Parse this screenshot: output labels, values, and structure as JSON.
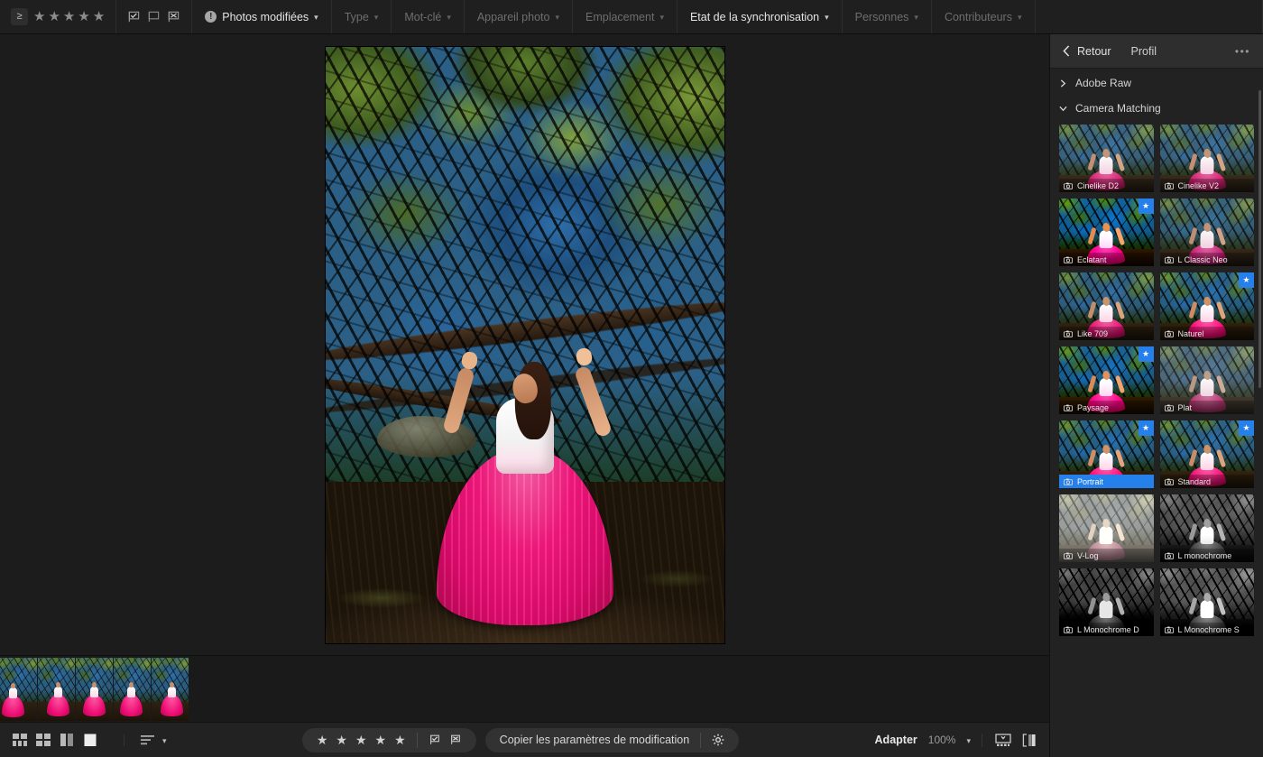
{
  "topbar": {
    "operator_label": "≥",
    "stars": [
      "star",
      "star",
      "star",
      "star",
      "star"
    ],
    "flags": [
      "flag-picked-icon",
      "flag-unflagged-icon",
      "flag-rejected-icon"
    ],
    "filters": [
      {
        "label": "Photos modifiées",
        "icon": "info-icon",
        "active": true
      },
      {
        "label": "Type",
        "active": false
      },
      {
        "label": "Mot-clé",
        "active": false
      },
      {
        "label": "Appareil photo",
        "active": false
      },
      {
        "label": "Emplacement",
        "active": false
      },
      {
        "label": "Etat de la synchronisation",
        "active": true
      },
      {
        "label": "Personnes",
        "active": false
      },
      {
        "label": "Contributeurs",
        "active": false
      }
    ]
  },
  "right_panel": {
    "back_label": "Retour",
    "title": "Profil",
    "more_label": "•••",
    "accent_color": "#2680eb",
    "groups": [
      {
        "name": "Adobe Raw",
        "expanded": false,
        "chevron": "chevron-right-icon"
      },
      {
        "name": "Camera Matching",
        "expanded": true,
        "chevron": "chevron-down-icon"
      }
    ],
    "profiles": [
      {
        "label": "Cinelike D2",
        "look": "look-cinelike",
        "favorite": false,
        "selected": false
      },
      {
        "label": "Cinelike V2",
        "look": "look-cinelike",
        "favorite": false,
        "selected": false
      },
      {
        "label": "Eclatant",
        "look": "look-eclatant",
        "favorite": true,
        "selected": false
      },
      {
        "label": "L Classic Neo",
        "look": "look-neo",
        "favorite": false,
        "selected": false
      },
      {
        "label": "Like 709",
        "look": "look-like709",
        "favorite": false,
        "selected": false
      },
      {
        "label": "Naturel",
        "look": "look-naturel",
        "favorite": true,
        "selected": false
      },
      {
        "label": "Paysage",
        "look": "look-paysage",
        "favorite": true,
        "selected": false
      },
      {
        "label": "Plat",
        "look": "look-plat",
        "favorite": false,
        "selected": false
      },
      {
        "label": "Portrait",
        "look": "look-portrait",
        "favorite": true,
        "selected": true
      },
      {
        "label": "Standard",
        "look": "look-standard",
        "favorite": true,
        "selected": false
      },
      {
        "label": "V-Log",
        "look": "look-vlog",
        "favorite": false,
        "selected": false
      },
      {
        "label": "L monochrome",
        "look": "look-mono",
        "favorite": false,
        "selected": false
      },
      {
        "label": "L Monochrome D",
        "look": "look-monod",
        "favorite": false,
        "selected": false
      },
      {
        "label": "L Monochrome S",
        "look": "look-monos",
        "favorite": false,
        "selected": false
      }
    ]
  },
  "filmstrip": {
    "thumbnails": [
      {
        "pose": "pose1",
        "selected": false
      },
      {
        "pose": "pose2",
        "selected": false
      },
      {
        "pose": "pose3",
        "selected": false
      },
      {
        "pose": "pose4",
        "selected": true
      },
      {
        "pose": "pose5",
        "selected": false
      }
    ]
  },
  "bottombar": {
    "view_modes": [
      "grid-view-icon",
      "compact-grid-icon",
      "compare-view-icon",
      "single-photo-icon"
    ],
    "sort_icon": "sort-lines-icon",
    "sort_chevron": "chevron-down-icon",
    "rating_stars": [
      "star",
      "star",
      "star",
      "star",
      "star"
    ],
    "rating_flags": [
      "flag-picked-icon",
      "flag-rejected-icon"
    ],
    "copy_settings_label": "Copier les paramètres de modification",
    "settings_icon": "gear-icon",
    "zoom_label": "Adapter",
    "zoom_value": "100%",
    "zoom_chevron": "chevron-down-icon",
    "right_icons": [
      "filmstrip-toggle-icon",
      "before-after-icon"
    ]
  }
}
